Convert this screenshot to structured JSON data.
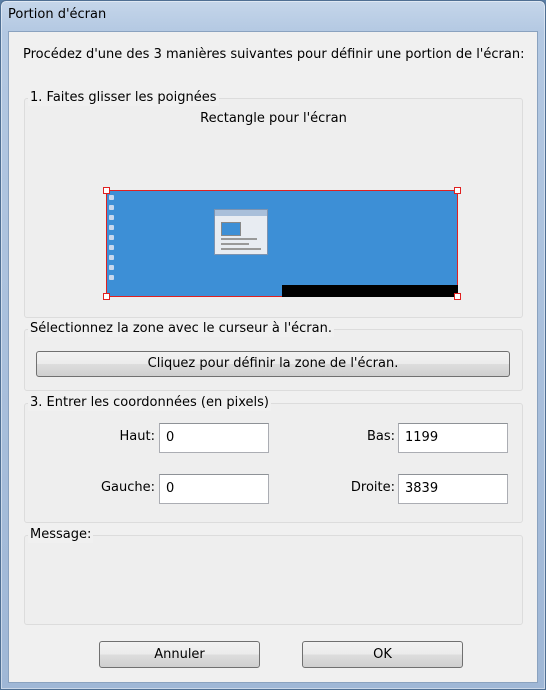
{
  "window": {
    "title": "Portion d'écran"
  },
  "intro_text": "Procédez d'une des 3 manières suivantes pour définir une portion de l'écran:",
  "group1": {
    "legend": "1. Faites glisser les poignées",
    "caption": "Rectangle pour l'écran"
  },
  "group2": {
    "legend": "Sélectionnez la zone avec le curseur à l'écran.",
    "button_label": "Cliquez pour définir la zone de l'écran."
  },
  "group3": {
    "legend": "3. Entrer les coordonnées (en pixels)",
    "haut_label": "Haut:",
    "haut_value": "0",
    "bas_label": "Bas:",
    "bas_value": "1199",
    "gauche_label": "Gauche:",
    "gauche_value": "0",
    "droite_label": "Droite:",
    "droite_value": "3839"
  },
  "message": {
    "legend": "Message:"
  },
  "buttons": {
    "cancel": "Annuler",
    "ok": "OK"
  },
  "colors": {
    "selection_border": "#e02020",
    "desktop_blue": "#3d8fd6"
  }
}
